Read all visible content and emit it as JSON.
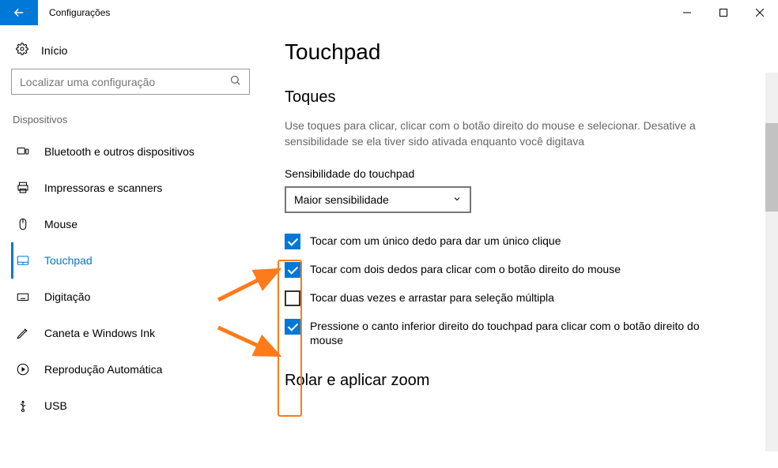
{
  "window": {
    "title": "Configurações"
  },
  "sidebar": {
    "home": "Início",
    "search_placeholder": "Localizar uma configuração",
    "section": "Dispositivos",
    "items": [
      {
        "label": "Bluetooth e outros dispositivos"
      },
      {
        "label": "Impressoras e scanners"
      },
      {
        "label": "Mouse"
      },
      {
        "label": "Touchpad"
      },
      {
        "label": "Digitação"
      },
      {
        "label": "Caneta e Windows Ink"
      },
      {
        "label": "Reprodução Automática"
      },
      {
        "label": "USB"
      }
    ]
  },
  "content": {
    "title": "Touchpad",
    "section1_title": "Toques",
    "section1_desc": "Use toques para clicar, clicar com o botão direito do mouse e selecionar. Desative a sensibilidade se ela tiver sido ativada enquanto você digitava",
    "sensitivity_label": "Sensibilidade do touchpad",
    "sensitivity_value": "Maior sensibilidade",
    "checks": [
      {
        "checked": true,
        "label": "Tocar com um único dedo para dar um único clique"
      },
      {
        "checked": true,
        "label": "Tocar com dois dedos para clicar com o botão direito do mouse"
      },
      {
        "checked": false,
        "label": "Tocar duas vezes e arrastar para seleção múltipla"
      },
      {
        "checked": true,
        "label": "Pressione o canto inferior direito do touchpad para clicar com o botão direito do mouse"
      }
    ],
    "section2_title": "Rolar e aplicar zoom"
  },
  "annotation": {
    "highlight_color": "#ff7a1a"
  }
}
